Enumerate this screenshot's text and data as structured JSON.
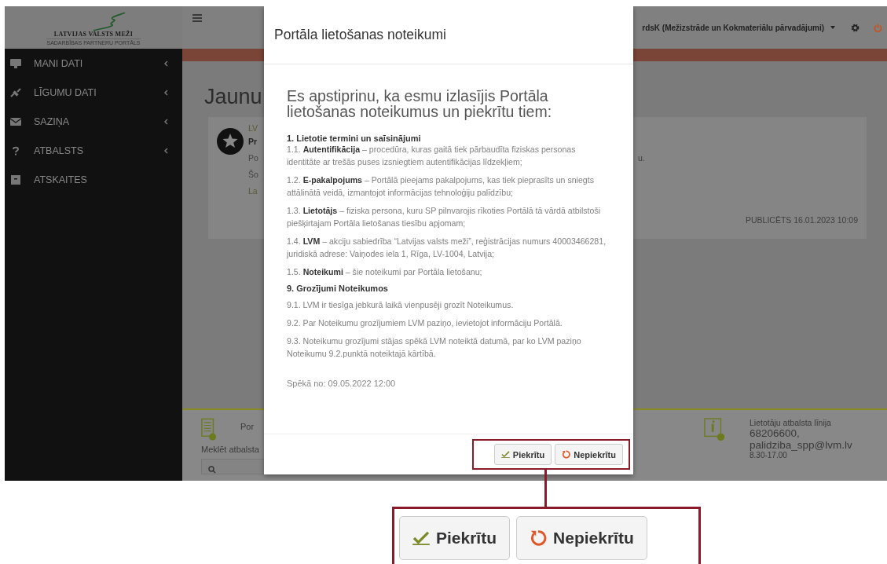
{
  "header": {
    "logo_title": "LATVIJAS VALSTS MEŽI",
    "logo_subtitle": "SADARBĪBAS PARTNERU PORTĀLS",
    "user": "rdsK (Mežizstrāde un Kokmateriālu pārvadājumi)"
  },
  "sidebar": {
    "items": [
      {
        "label": "MANI DATI",
        "has_submenu": true
      },
      {
        "label": "LĪGUMU DATI",
        "has_submenu": true
      },
      {
        "label": "SAZIŅA",
        "has_submenu": true
      },
      {
        "label": "ATBALSTS",
        "has_submenu": true
      },
      {
        "label": "ATSKAITES",
        "has_submenu": false
      }
    ]
  },
  "page": {
    "title": "Jaunu",
    "news": {
      "title": "LV",
      "subtitle": "Pr",
      "lines": [
        "Po",
        "Šo"
      ],
      "link": "La",
      "tail": "u.",
      "published": "PUBLICĒTS 16.01.2023 10:09"
    }
  },
  "footer": {
    "left_title": "Por",
    "search_label": "Meklēt atbalsta",
    "support_title": "Lietotāju atbalsta līnija",
    "phone": "68206600,",
    "email": "palidziba_spp@lvm.lv",
    "hours": "8.30-17.00"
  },
  "modal": {
    "title": "Portāla lietošanas noteikumi",
    "heading": "Es apstiprinu, ka esmu izlasījis Portāla lietošanas noteikumus un piekrītu tiem:",
    "sections": [
      {
        "heading": "1. Lietotie termini un saīsinājumi",
        "items": [
          "1.1. **Autentifikācija** – procedūra, kuras gaitā tiek pārbaudīta fiziskas personas identitāte ar trešās puses izsniegtiem autentifikācijas līdzekļiem;",
          "1.2. **E-pakalpojums** – Portālā pieejams pakalpojums, kas tiek pieprasīts un sniegts attālinātā veidā, izmantojot informācijas tehnoloģiju palīdzību;",
          "1.3. **Lietotājs** – fiziska persona, kuru SP pilnvarojis rīkoties Portālā tā vārdā atbilstoši piešķirtajam Portāla lietošanas tiesību apjomam;",
          "1.4. **LVM** – akciju sabiedrība “Latvijas valsts meži”, reģistrācijas numurs 40003466281, juridiskā adrese: Vaiņodes iela 1, Rīga, LV-1004, Latvija;",
          "1.5. **Noteikumi** – šie noteikumi par Portāla lietošanu;"
        ]
      },
      {
        "heading": "9. Grozījumi Noteikumos",
        "items": [
          "9.1. LVM ir tiesīga jebkurā laikā vienpusēji grozīt Noteikumus.",
          "9.2. Par Noteikumu grozījumiem LVM paziņo, ievietojot informāciju Portālā.",
          "9.3. Noteikumu grozījumi stājas spēkā LVM noteiktā datumā, par ko LVM paziņo Noteikumu 9.2.punktā noteiktajā kārtībā."
        ]
      }
    ],
    "effective": "Spēkā no: 09.05.2022 12:00",
    "buttons": [
      {
        "label": "Piekrītu",
        "kind": "accept"
      },
      {
        "label": "Nepiekrītu",
        "kind": "decline"
      }
    ]
  },
  "callout": {
    "buttons": [
      {
        "label": "Piekrītu",
        "kind": "accept"
      },
      {
        "label": "Nepiekrītu",
        "kind": "decline"
      }
    ]
  }
}
